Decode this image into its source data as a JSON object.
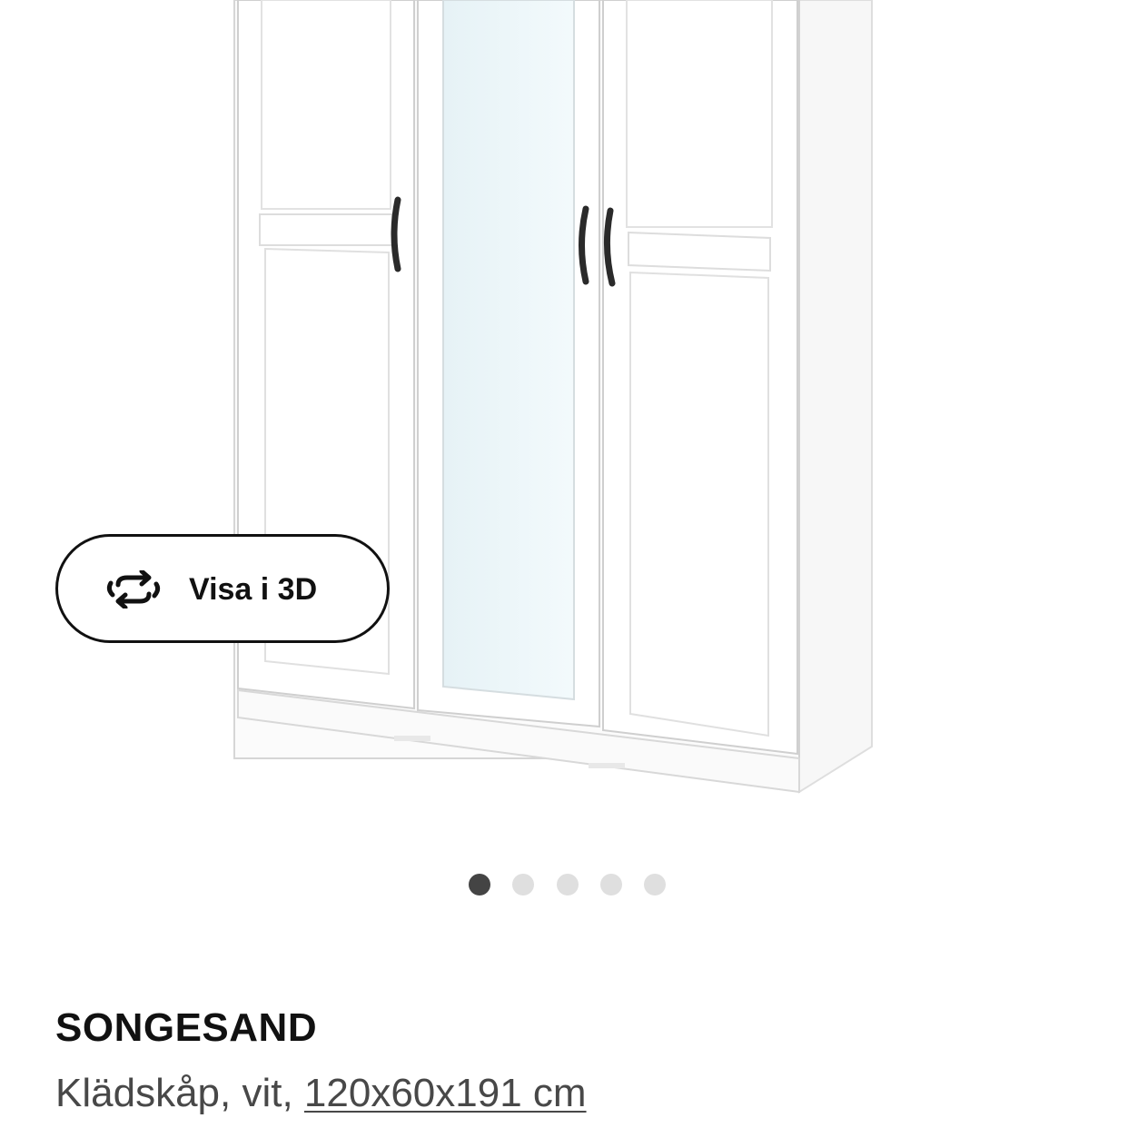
{
  "view_3d": {
    "label": "Visa i 3D",
    "icon": "rotate-arrows-icon"
  },
  "carousel": {
    "total": 5,
    "active_index": 1,
    "active_color": "#444444",
    "inactive_color": "#dfdfdf"
  },
  "product": {
    "name": "SONGESAND",
    "description_prefix": "Klädskåp, vit, ",
    "dimensions": "120x60x191 cm"
  }
}
